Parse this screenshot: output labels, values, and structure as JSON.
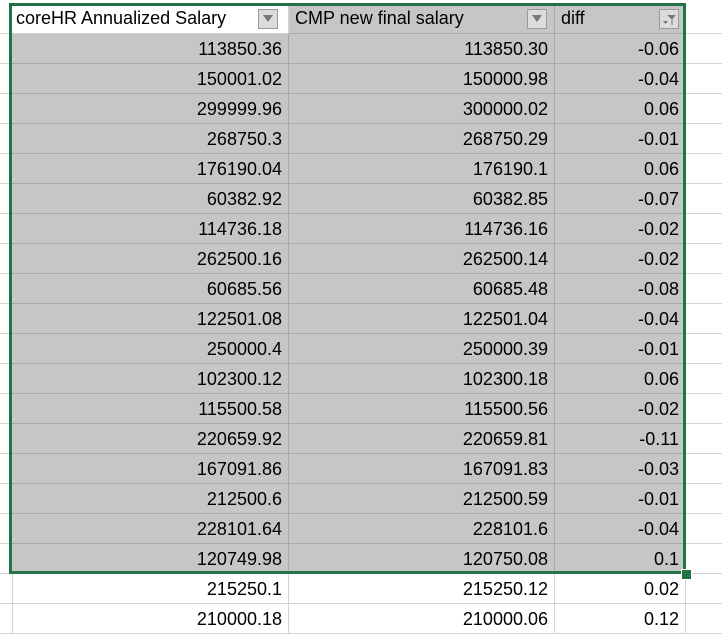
{
  "headers": [
    "coreHR Annualized Salary",
    "CMP new final salary",
    "diff"
  ],
  "rows": [
    [
      "113850.36",
      "113850.30",
      "-0.06"
    ],
    [
      "150001.02",
      "150000.98",
      "-0.04"
    ],
    [
      "299999.96",
      "300000.02",
      "0.06"
    ],
    [
      "268750.3",
      "268750.29",
      "-0.01"
    ],
    [
      "176190.04",
      "176190.1",
      "0.06"
    ],
    [
      "60382.92",
      "60382.85",
      "-0.07"
    ],
    [
      "114736.18",
      "114736.16",
      "-0.02"
    ],
    [
      "262500.16",
      "262500.14",
      "-0.02"
    ],
    [
      "60685.56",
      "60685.48",
      "-0.08"
    ],
    [
      "122501.08",
      "122501.04",
      "-0.04"
    ],
    [
      "250000.4",
      "250000.39",
      "-0.01"
    ],
    [
      "102300.12",
      "102300.18",
      "0.06"
    ],
    [
      "115500.58",
      "115500.56",
      "-0.02"
    ],
    [
      "220659.92",
      "220659.81",
      "-0.11"
    ],
    [
      "167091.86",
      "167091.83",
      "-0.03"
    ],
    [
      "212500.6",
      "212500.59",
      "-0.01"
    ],
    [
      "228101.64",
      "228101.6",
      "-0.04"
    ],
    [
      "120749.98",
      "120750.08",
      "0.1"
    ],
    [
      "215250.1",
      "215250.12",
      "0.02"
    ],
    [
      "210000.18",
      "210000.06",
      "0.12"
    ]
  ],
  "selected_row_count": 18,
  "colors": {
    "selection_border": "#217346",
    "selected_fill": "#c6c6c6"
  }
}
